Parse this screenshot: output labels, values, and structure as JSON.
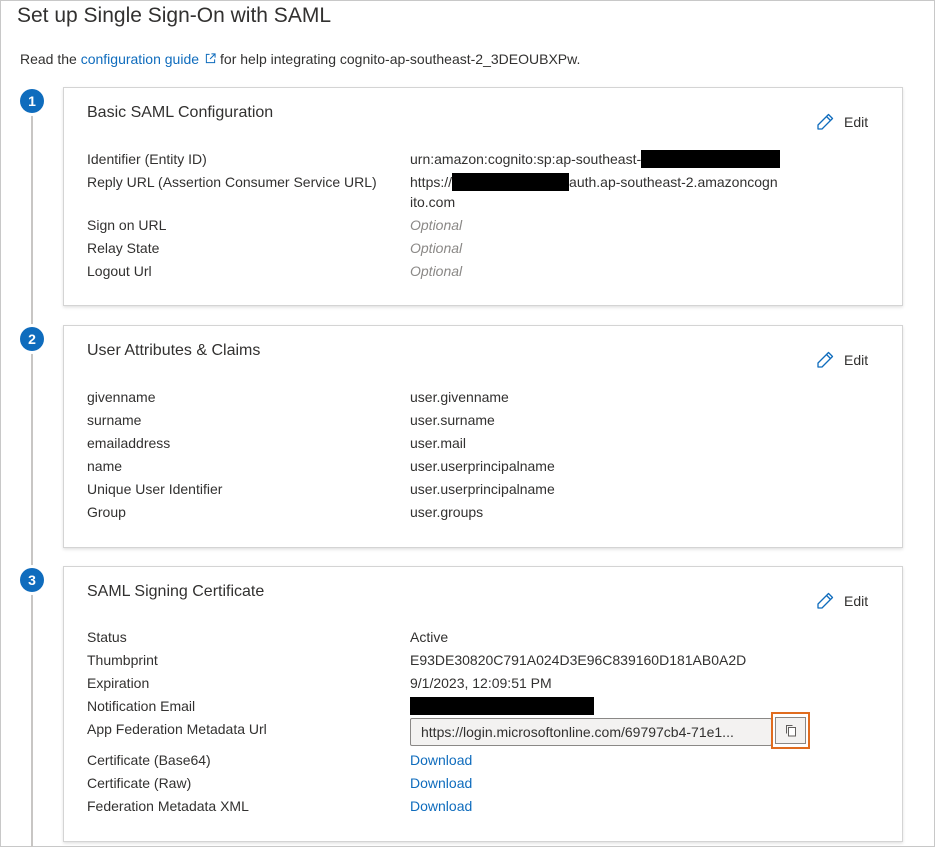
{
  "page": {
    "title": "Set up Single Sign-On with SAML",
    "intro_prefix": "Read the",
    "intro_link": "configuration guide",
    "intro_suffix": "for help integrating cognito-ap-southeast-2_3DEOUBXPw."
  },
  "icons": {
    "external_link": "external-link-icon",
    "edit": "pencil-icon",
    "copy": "copy-icon"
  },
  "colors": {
    "accent": "#0f6cbd",
    "highlight": "#e06c1f",
    "optional_text": "#8a8886"
  },
  "edit_label": "Edit",
  "sections": [
    {
      "step": "1",
      "title": "Basic SAML Configuration",
      "rows": [
        {
          "label": "Identifier (Entity ID)",
          "value": "urn:amazon:cognito:sp:ap-southeast-"
        },
        {
          "label": "Reply URL (Assertion Consumer Service URL)",
          "value_prefix": "https://",
          "value_suffix": "auth.ap-southeast-2.amazoncogn",
          "value_line2": "ito.com"
        },
        {
          "label": "Sign on URL",
          "value": "Optional"
        },
        {
          "label": "Relay State",
          "value": "Optional"
        },
        {
          "label": "Logout Url",
          "value": "Optional"
        }
      ]
    },
    {
      "step": "2",
      "title": "User Attributes & Claims",
      "rows": [
        {
          "label": "givenname",
          "value": "user.givenname"
        },
        {
          "label": "surname",
          "value": "user.surname"
        },
        {
          "label": "emailaddress",
          "value": "user.mail"
        },
        {
          "label": "name",
          "value": "user.userprincipalname"
        },
        {
          "label": "Unique User Identifier",
          "value": "user.userprincipalname"
        },
        {
          "label": "Group",
          "value": "user.groups"
        }
      ]
    },
    {
      "step": "3",
      "title": "SAML Signing Certificate",
      "rows": [
        {
          "label": "Status",
          "value": "Active"
        },
        {
          "label": "Thumbprint",
          "value": "E93DE30820C791A024D3E96C839160D181AB0A2D"
        },
        {
          "label": "Expiration",
          "value": "9/1/2023, 12:09:51 PM"
        },
        {
          "label": "Notification Email"
        },
        {
          "label": "App Federation Metadata Url",
          "value": "https://login.microsoftonline.com/69797cb4-71e1..."
        },
        {
          "label": "Certificate (Base64)",
          "value": "Download"
        },
        {
          "label": "Certificate (Raw)",
          "value": "Download"
        },
        {
          "label": "Federation Metadata XML",
          "value": "Download"
        }
      ]
    }
  ]
}
